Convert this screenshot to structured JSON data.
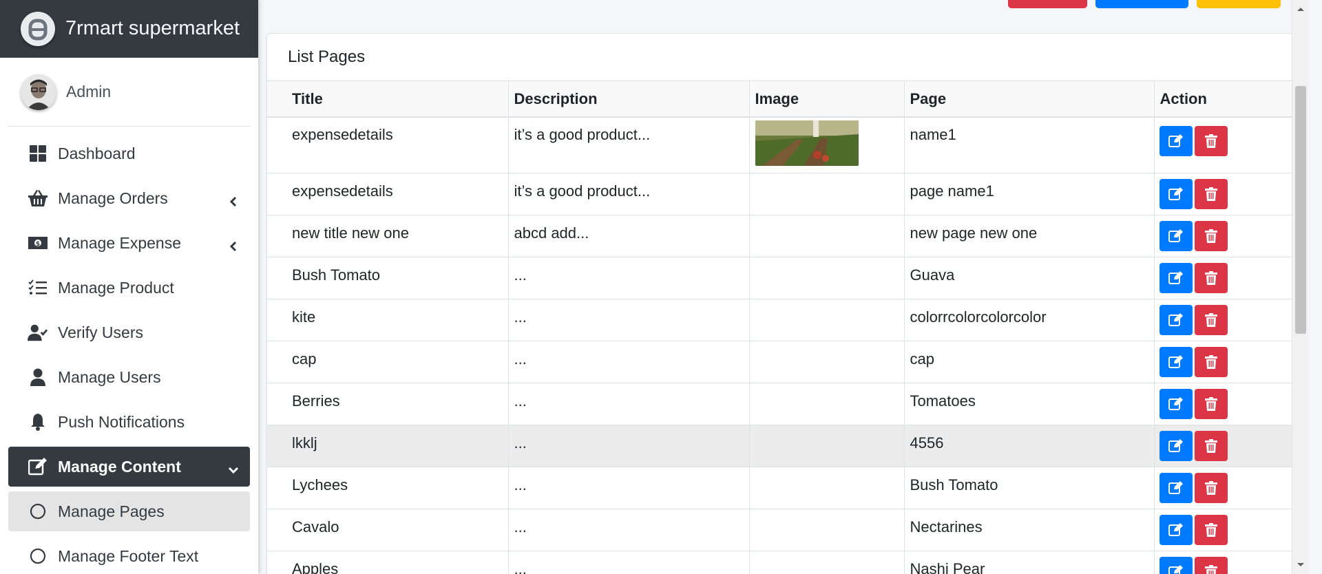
{
  "brand": {
    "name": "7rmart supermarket"
  },
  "user": {
    "name": "Admin"
  },
  "sidebar": {
    "items": [
      {
        "label": "Dashboard",
        "icon": "dashboard-icon"
      },
      {
        "label": "Manage Orders",
        "icon": "basket-icon",
        "has_chevron": true
      },
      {
        "label": "Manage Expense",
        "icon": "money-icon",
        "has_chevron": true
      },
      {
        "label": "Manage Product",
        "icon": "task-list-icon"
      },
      {
        "label": "Verify Users",
        "icon": "user-check-icon"
      },
      {
        "label": "Manage Users",
        "icon": "user-icon"
      },
      {
        "label": "Push Notifications",
        "icon": "bell-icon"
      },
      {
        "label": "Manage Content",
        "icon": "edit-icon",
        "active": true
      },
      {
        "label": "Manage Pages",
        "icon": "circle-icon",
        "sub_active": true
      },
      {
        "label": "Manage Footer Text",
        "icon": "circle-icon"
      }
    ]
  },
  "top_buttons": [
    {
      "color": "#dc3545"
    },
    {
      "color": "#007bff"
    },
    {
      "color": "#ffc107"
    }
  ],
  "card": {
    "title": "List Pages"
  },
  "table": {
    "headers": [
      "Title",
      "Description",
      "Image",
      "Page",
      "Action"
    ],
    "rows": [
      {
        "title": "expensedetails",
        "description": "it’s a good product...",
        "has_image": true,
        "page": "name1"
      },
      {
        "title": "expensedetails",
        "description": "it’s a good product...",
        "page": "page name1"
      },
      {
        "title": "new title new one",
        "description": "abcd add...",
        "page": "new page new one"
      },
      {
        "title": "Bush Tomato",
        "description": "...",
        "page": "Guava"
      },
      {
        "title": "kite",
        "description": "...",
        "page": "colorrcolorcolorcolor"
      },
      {
        "title": "cap",
        "description": "...",
        "page": "cap"
      },
      {
        "title": "Berries",
        "description": "...",
        "page": "Tomatoes"
      },
      {
        "title": "lkklj",
        "description": "...",
        "page": "4556",
        "highlighted": true
      },
      {
        "title": "Lychees",
        "description": "...",
        "page": "Bush Tomato"
      },
      {
        "title": "Cavalo",
        "description": "...",
        "page": "Nectarines"
      },
      {
        "title": "Apples",
        "description": "...",
        "page": "Nashi Pear"
      }
    ]
  },
  "colors": {
    "sidebar_dark": "#343a40",
    "edit_button": "#007bff",
    "delete_button": "#dc3545"
  }
}
